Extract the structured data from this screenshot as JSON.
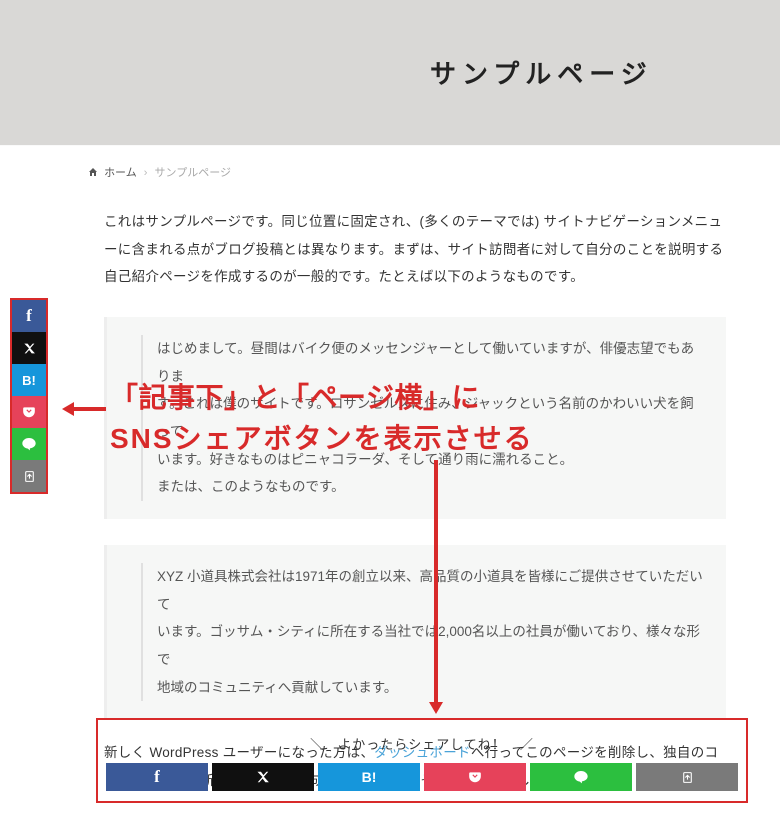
{
  "header": {
    "title": "サンプルページ"
  },
  "breadcrumb": {
    "home": "ホーム",
    "current": "サンプルページ"
  },
  "paragraphs": {
    "p1": "これはサンプルページです。同じ位置に固定され、(多くのテーマでは) サイトナビゲーションメニューに含まれる点がブログ投稿とは異なります。まずは、サイト訪問者に対して自分のことを説明する自己紹介ページを作成するのが一般的です。たとえば以下のようなものです。",
    "block1_l1": "はじめまして。昼間はバイク便のメッセンジャーとして働いていますが、俳優志望でもありま",
    "block1_l2": "す。これは僕のサイトです。ロサンゼルスに住み、ジャックという名前のかわいい犬を飼って",
    "block1_l3": "います。好きなものはピニャコラーダ、そして通り雨に濡れること。",
    "block1_l4": "または、このようなものです。",
    "block2_l1": "XYZ 小道具株式会社は1971年の創立以来、高品質の小道具を皆様にご提供させていただいて",
    "block2_l2": "います。ゴッサム・シティに所在する当社では2,000名以上の社員が働いており、様々な形で",
    "block2_l3": "地域のコミュニティへ貢献しています。",
    "p2_a": "新しく WordPress ユーザーになった方は、",
    "p2_link": "ダッシュボード",
    "p2_b": "へ行ってこのページを削除し、独自のコンテンツを含む新しいページを作成してください。それでは、お楽しみください !"
  },
  "annotation": {
    "line1": "「記事下」と「ページ横」に",
    "line2": "SNSシェアボタンを表示させる"
  },
  "share": {
    "bottom_label": "よかったらシェアしてね！",
    "services": {
      "facebook": "f",
      "x": "X",
      "hatena": "B!",
      "pocket": "pocket-icon",
      "line": "line-icon",
      "copy": "copy-icon"
    }
  }
}
